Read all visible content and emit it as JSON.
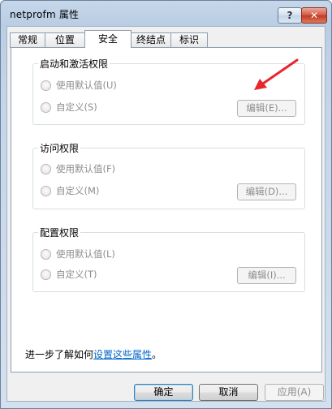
{
  "window": {
    "title": "netprofm 属性",
    "help_label": "?",
    "close_label": "✕"
  },
  "tabs": [
    {
      "label": "常规",
      "active": false
    },
    {
      "label": "位置",
      "active": false
    },
    {
      "label": "安全",
      "active": true
    },
    {
      "label": "终结点",
      "active": false
    },
    {
      "label": "标识",
      "active": false
    }
  ],
  "groups": [
    {
      "title": "启动和激活权限",
      "default_label": "使用默认值(U)",
      "custom_label": "自定义(S)",
      "edit_label": "编辑(E)..."
    },
    {
      "title": "访问权限",
      "default_label": "使用默认值(F)",
      "custom_label": "自定义(M)",
      "edit_label": "编辑(D)..."
    },
    {
      "title": "配置权限",
      "default_label": "使用默认值(L)",
      "custom_label": "自定义(T)",
      "edit_label": "编辑(I)..."
    }
  ],
  "help": {
    "prefix": "进一步了解如何",
    "link": "设置这些属性",
    "suffix": "。"
  },
  "footer": {
    "ok": "确定",
    "cancel": "取消",
    "apply": "应用(A)"
  },
  "annotation": {
    "arrow_color": "#e8262b"
  }
}
